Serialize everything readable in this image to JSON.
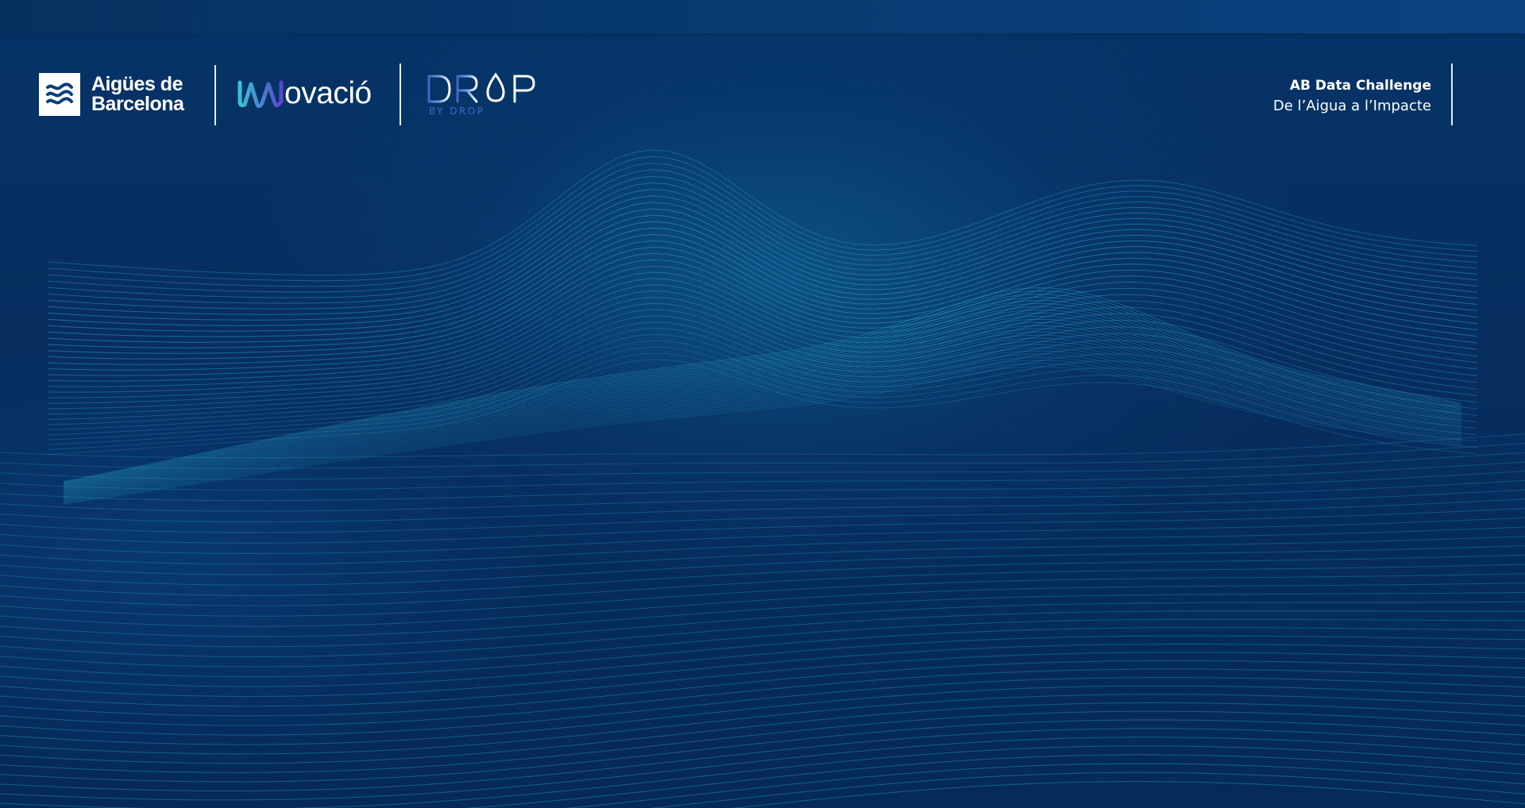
{
  "header": {
    "brand_logo": {
      "name": "Aigües de Barcelona",
      "line1": "Aigües de",
      "line2": "Barcelona",
      "icon": "wave-mark-icon"
    },
    "innovation_logo": {
      "text": "ovació",
      "icon": "innovation-mark-icon"
    },
    "drop_logo": {
      "wordmark": "DROP",
      "tagline": "BY DROP",
      "icon": "drop-logo-icon"
    },
    "challenge": {
      "title": "AB Data Challenge",
      "subtitle": "De l’Aigua a l’Impacte"
    }
  },
  "colors": {
    "background": "#072f5e",
    "wave_lines": "#2aa7c9",
    "drop_blue": "#3e69c4",
    "innovation_gradient_start": "#36c3d8",
    "innovation_gradient_end": "#5b46c6"
  }
}
